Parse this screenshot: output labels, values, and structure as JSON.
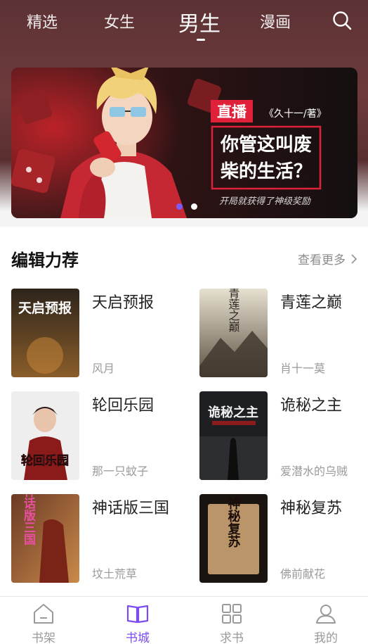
{
  "top_tabs": {
    "items": [
      {
        "label": "精选"
      },
      {
        "label": "女生"
      },
      {
        "label": "男生"
      },
      {
        "label": "漫画"
      }
    ],
    "active": "男生"
  },
  "banner": {
    "tag": "直播",
    "author": "《久十一/著》",
    "title_line1": "你管这叫废",
    "title_line2": "柴的生活？",
    "subtitle": "开局就获得了神级奖励",
    "dots": 2,
    "active_dot": 1
  },
  "section": {
    "title": "编辑力荐",
    "more_label": "查看更多",
    "books": [
      {
        "title": "天启预报",
        "author": "风月",
        "cover_text": "天启预报",
        "cover_colors": [
          "#3a2a1c",
          "#b58a4a"
        ]
      },
      {
        "title": "青莲之巅",
        "author": "肖十一莫",
        "cover_text": "青莲之巅",
        "cover_colors": [
          "#d8d2c2",
          "#6b5d45"
        ]
      },
      {
        "title": "轮回乐园",
        "author": "那一只蚊子",
        "cover_text": "轮回乐园",
        "cover_colors": [
          "#f1f0f0",
          "#8b1a1a"
        ]
      },
      {
        "title": "诡秘之主",
        "author": "爱潜水的乌贼",
        "cover_text": "诡秘之主",
        "cover_colors": [
          "#1d1f22",
          "#8a1c1c"
        ]
      },
      {
        "title": "神话版三国",
        "author": "坟土荒草",
        "cover_text": "神话版三国",
        "cover_colors": [
          "#5c3020",
          "#c98a4a"
        ]
      },
      {
        "title": "神秘复苏",
        "author": "佛前献花",
        "cover_text": "神秘复苏",
        "cover_colors": [
          "#1a1410",
          "#c7a57a"
        ]
      }
    ]
  },
  "bottom_nav": {
    "items": [
      {
        "label": "书架",
        "icon": "bookshelf-icon"
      },
      {
        "label": "书城",
        "icon": "bookstore-icon"
      },
      {
        "label": "求书",
        "icon": "grid-icon"
      },
      {
        "label": "我的",
        "icon": "profile-icon"
      }
    ],
    "active": "书城"
  },
  "colors": {
    "accent": "#7b4cf2",
    "banner_red": "#e0213a"
  }
}
